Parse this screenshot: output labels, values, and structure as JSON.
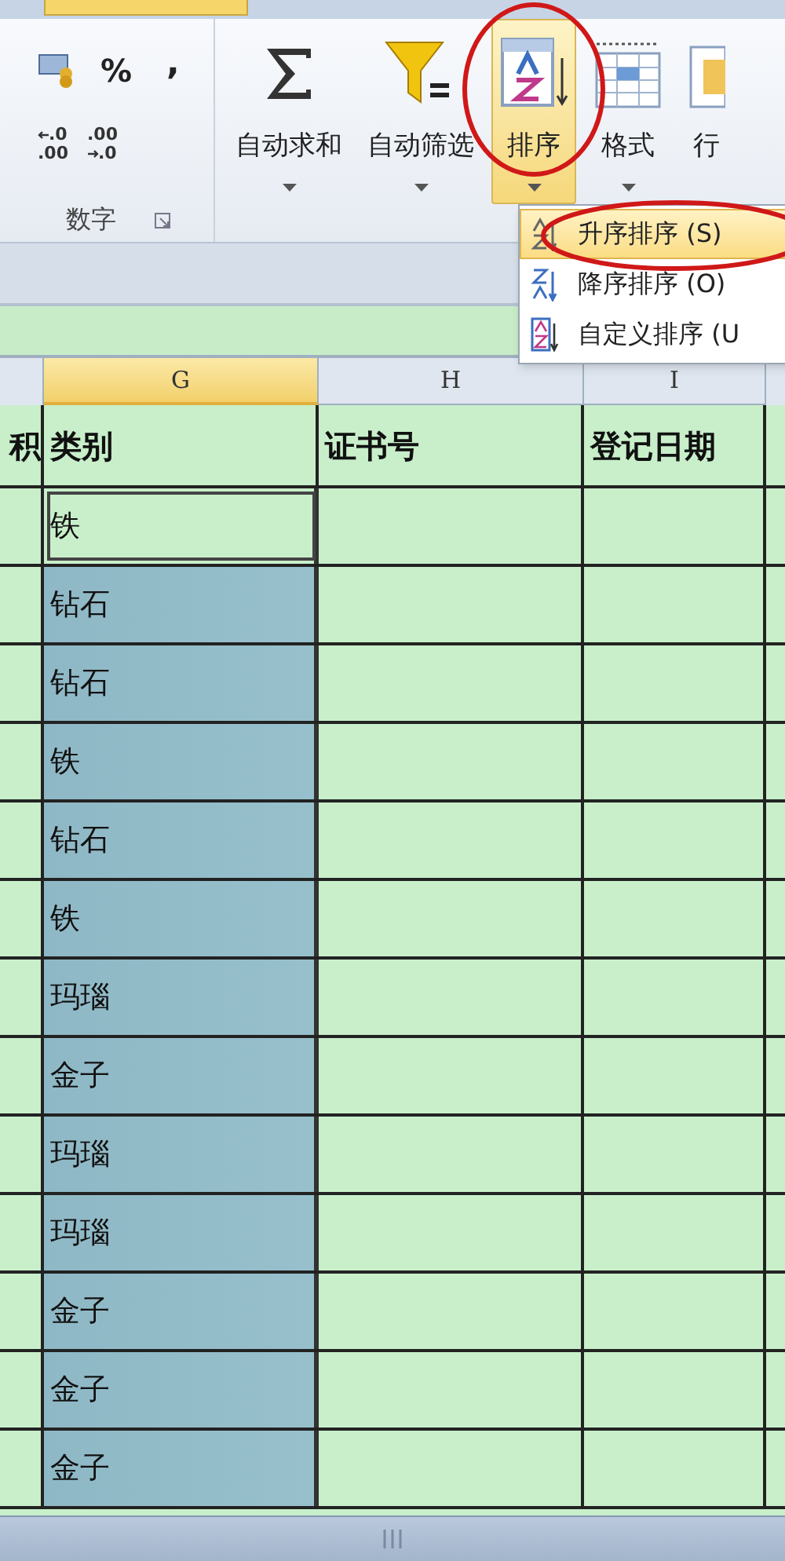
{
  "ribbon": {
    "number_group": {
      "label": "数字",
      "percent": "%",
      "comma": ",",
      "increase_decimal": [
        ".0",
        ".00"
      ],
      "decrease_decimal": [
        ".00",
        ".0"
      ]
    },
    "buttons": [
      {
        "label": "自动求和",
        "kind": "sum",
        "selected": false,
        "dropdown": true
      },
      {
        "label": "自动筛选",
        "kind": "filter",
        "selected": false,
        "dropdown": true
      },
      {
        "label": "排序",
        "kind": "sort",
        "selected": true,
        "dropdown": true
      },
      {
        "label": "格式",
        "kind": "format",
        "selected": false,
        "dropdown": true
      },
      {
        "label": "行",
        "kind": "rows",
        "selected": false,
        "dropdown": false
      }
    ]
  },
  "sort_menu": {
    "items": [
      {
        "label": "升序排序 (S)",
        "kind": "asc",
        "highlighted": true
      },
      {
        "label": "降序排序 (O)",
        "kind": "desc",
        "highlighted": false
      },
      {
        "label": "自定义排序 (U",
        "kind": "custom",
        "highlighted": false
      }
    ]
  },
  "sheet": {
    "columns": [
      {
        "label": "G",
        "selected": true
      },
      {
        "label": "H",
        "selected": false
      },
      {
        "label": "I",
        "selected": false
      }
    ],
    "header_row": [
      "积",
      "类别",
      "证书号",
      "登记日期"
    ],
    "rows": [
      {
        "category": "铁",
        "active": true
      },
      {
        "category": "钻石",
        "active": false
      },
      {
        "category": "钻石",
        "active": false
      },
      {
        "category": "铁",
        "active": false
      },
      {
        "category": "钻石",
        "active": false
      },
      {
        "category": "铁",
        "active": false
      },
      {
        "category": "玛瑙",
        "active": false
      },
      {
        "category": "金子",
        "active": false
      },
      {
        "category": "玛瑙",
        "active": false
      },
      {
        "category": "玛瑙",
        "active": false
      },
      {
        "category": "金子",
        "active": false
      },
      {
        "category": "金子",
        "active": false
      },
      {
        "category": "金子",
        "active": false
      }
    ]
  }
}
